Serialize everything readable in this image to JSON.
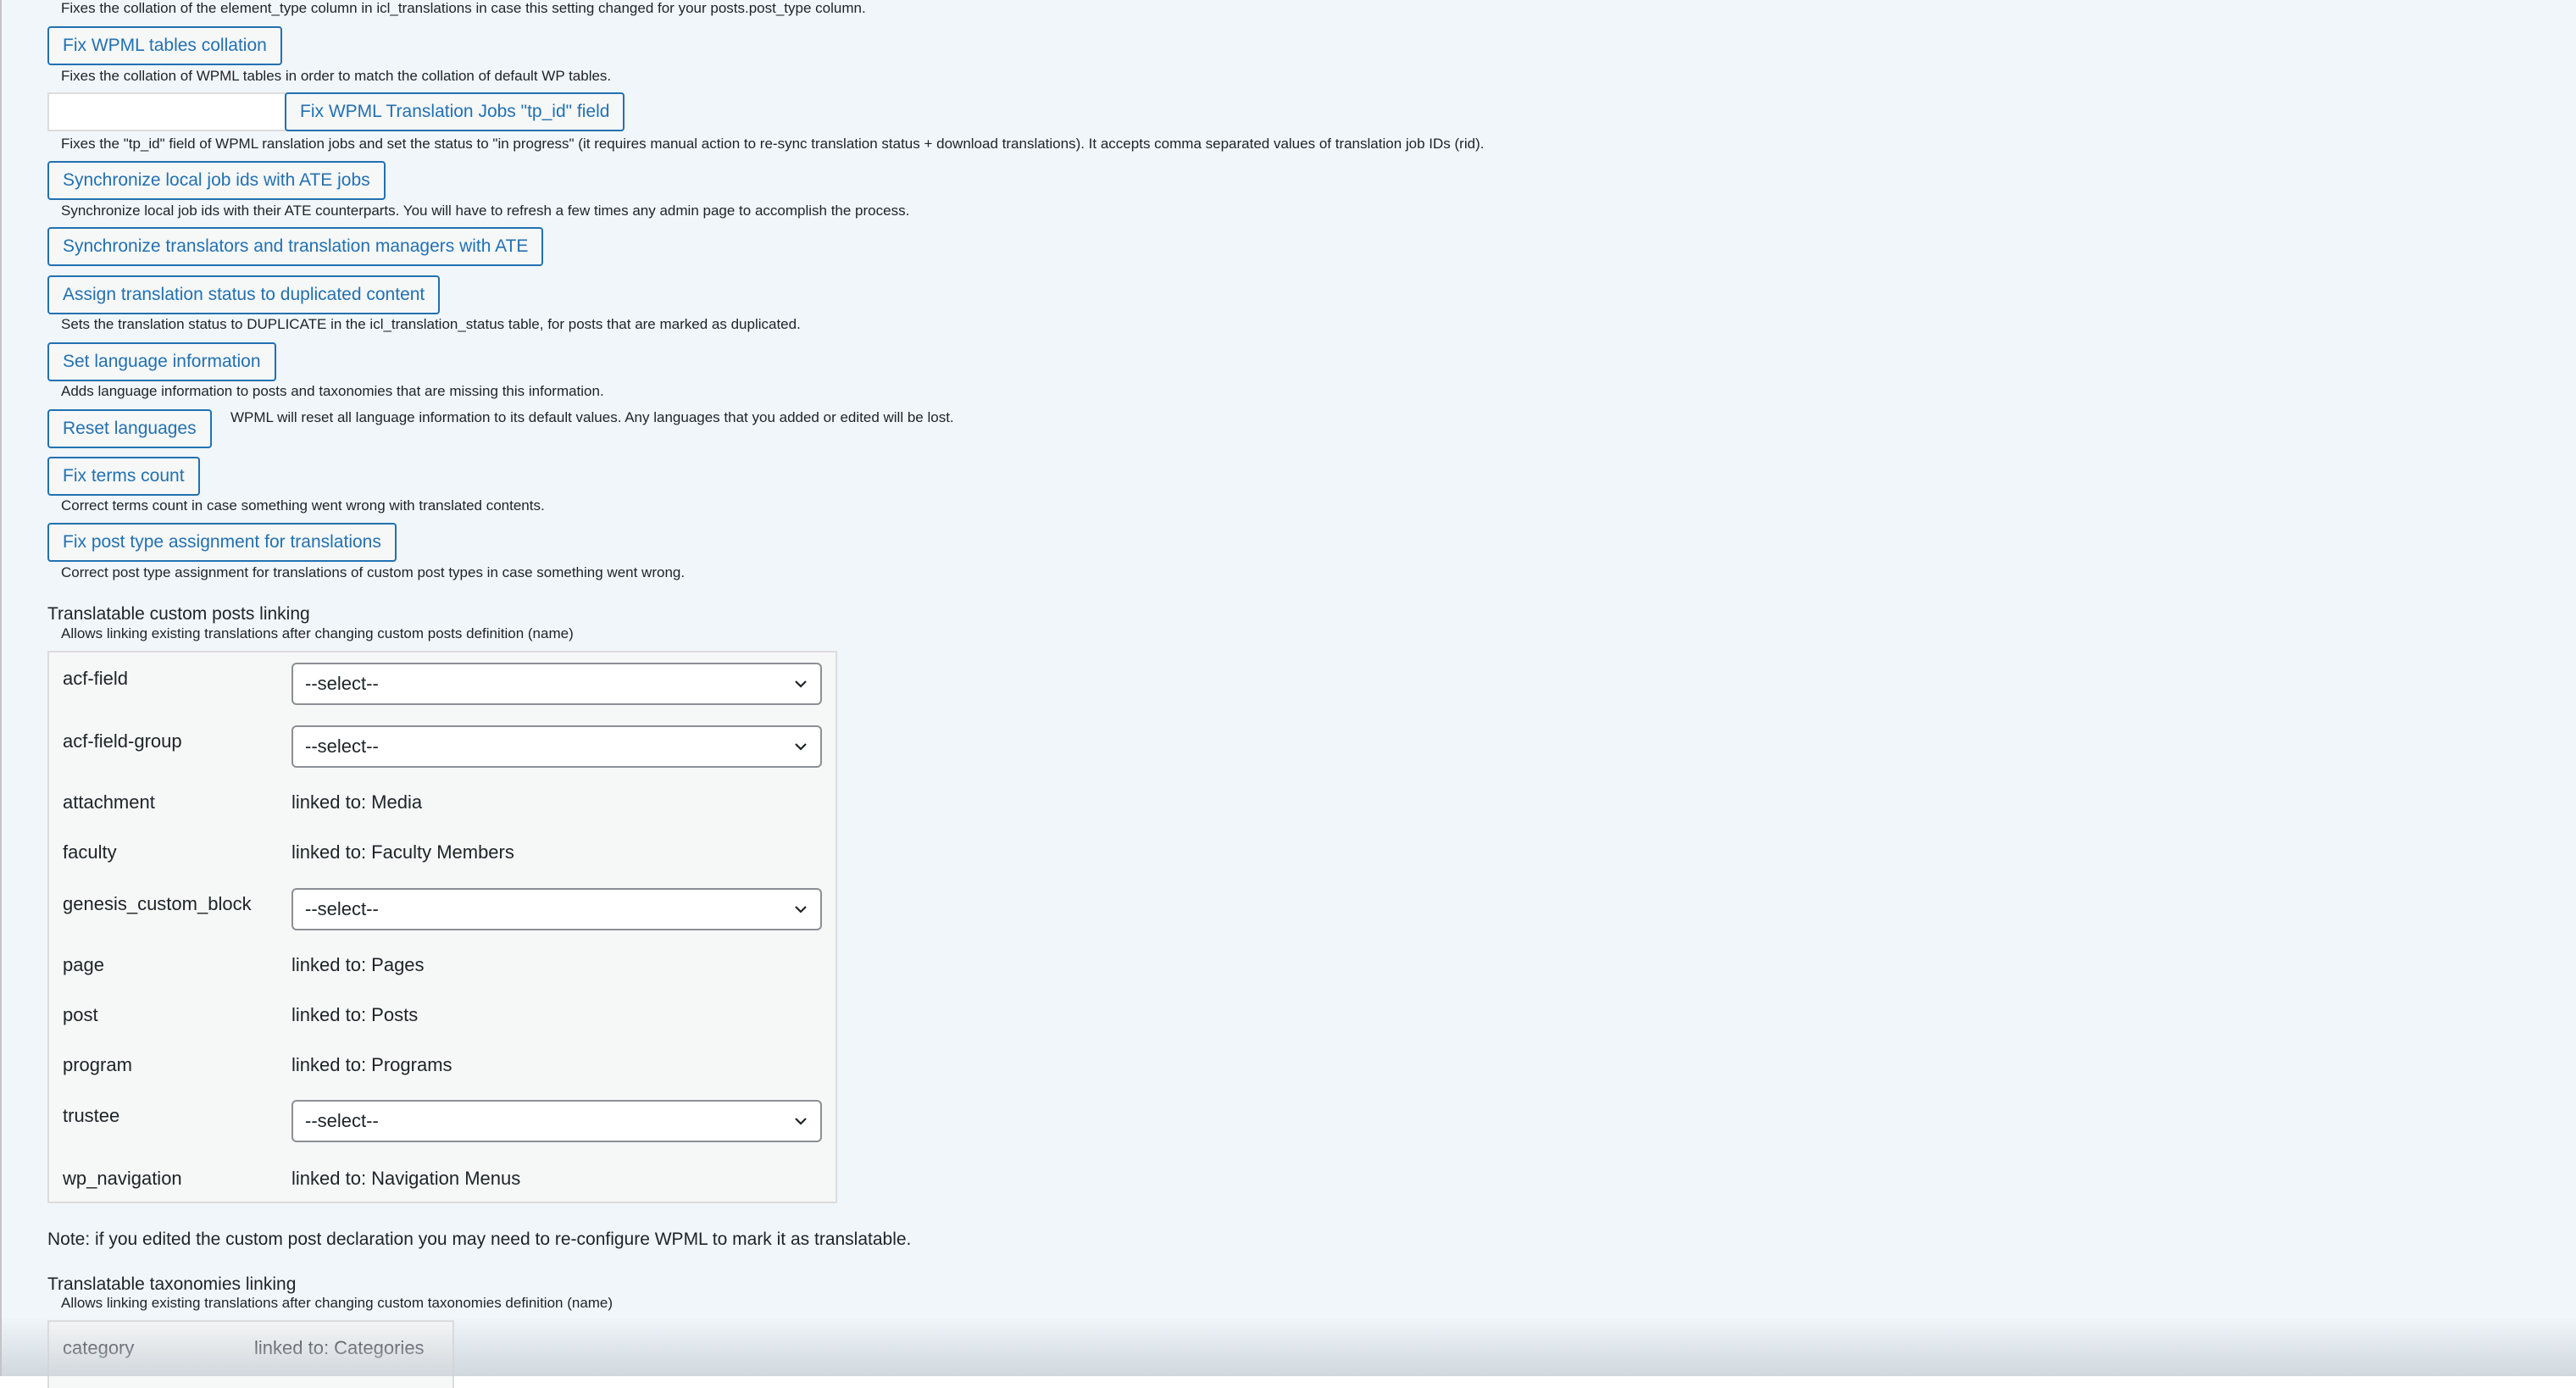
{
  "tools": {
    "element_type_desc": "Fixes the collation of the element_type column in icl_translations in case this setting changed for your posts.post_type column.",
    "fix_tables_label": "Fix WPML tables collation",
    "fix_tables_desc": "Fixes the collation of WPML tables in order to match the collation of default WP tables.",
    "tp_id_input_value": "",
    "fix_tp_id_label": "Fix WPML Translation Jobs \"tp_id\" field",
    "fix_tp_id_desc": "Fixes the \"tp_id\" field of WPML ranslation jobs and set the status to \"in progress\" (it requires manual action to re-sync translation status + download translations). It accepts comma separated values of translation job IDs (rid).",
    "sync_jobs_label": "Synchronize local job ids with ATE jobs",
    "sync_jobs_desc": "Synchronize local job ids with their ATE counterparts. You will have to refresh a few times any admin page to accomplish the process.",
    "sync_translators_label": "Synchronize translators and translation managers with ATE",
    "assign_status_label": "Assign translation status to duplicated content",
    "assign_status_desc": "Sets the translation status to DUPLICATE in the icl_translation_status table, for posts that are marked as duplicated.",
    "set_language_label": "Set language information",
    "set_language_desc": "Adds language information to posts and taxonomies that are missing this information.",
    "reset_languages_label": "Reset languages",
    "reset_languages_desc": "WPML will reset all language information to its default values. Any languages that you added or edited will be lost.",
    "fix_terms_label": "Fix terms count",
    "fix_terms_desc": "Correct terms count in case something went wrong with translated contents.",
    "fix_post_type_label": "Fix post type assignment for translations",
    "fix_post_type_desc": "Correct post type assignment for translations of custom post types in case something went wrong."
  },
  "custom_posts": {
    "title": "Translatable custom posts linking",
    "subtitle": "Allows linking existing translations after changing custom posts definition (name)",
    "rows": [
      {
        "name": "acf-field",
        "select": "--select--"
      },
      {
        "name": "acf-field-group",
        "select": "--select--"
      },
      {
        "name": "attachment",
        "linked": "linked to: Media"
      },
      {
        "name": "faculty",
        "linked": "linked to: Faculty Members"
      },
      {
        "name": "genesis_custom_block",
        "select": "--select--"
      },
      {
        "name": "page",
        "linked": "linked to: Pages"
      },
      {
        "name": "post",
        "linked": "linked to: Posts"
      },
      {
        "name": "program",
        "linked": "linked to: Programs"
      },
      {
        "name": "trustee",
        "select": "--select--"
      },
      {
        "name": "wp_navigation",
        "linked": "linked to: Navigation Menus"
      }
    ],
    "note": "Note: if you edited the custom post declaration you may need to re-configure WPML to mark it as translatable."
  },
  "taxonomies": {
    "title": "Translatable taxonomies linking",
    "subtitle": "Allows linking existing translations after changing custom taxonomies definition (name)",
    "rows": [
      {
        "name": "category",
        "linked": "linked to: Categories"
      }
    ]
  }
}
